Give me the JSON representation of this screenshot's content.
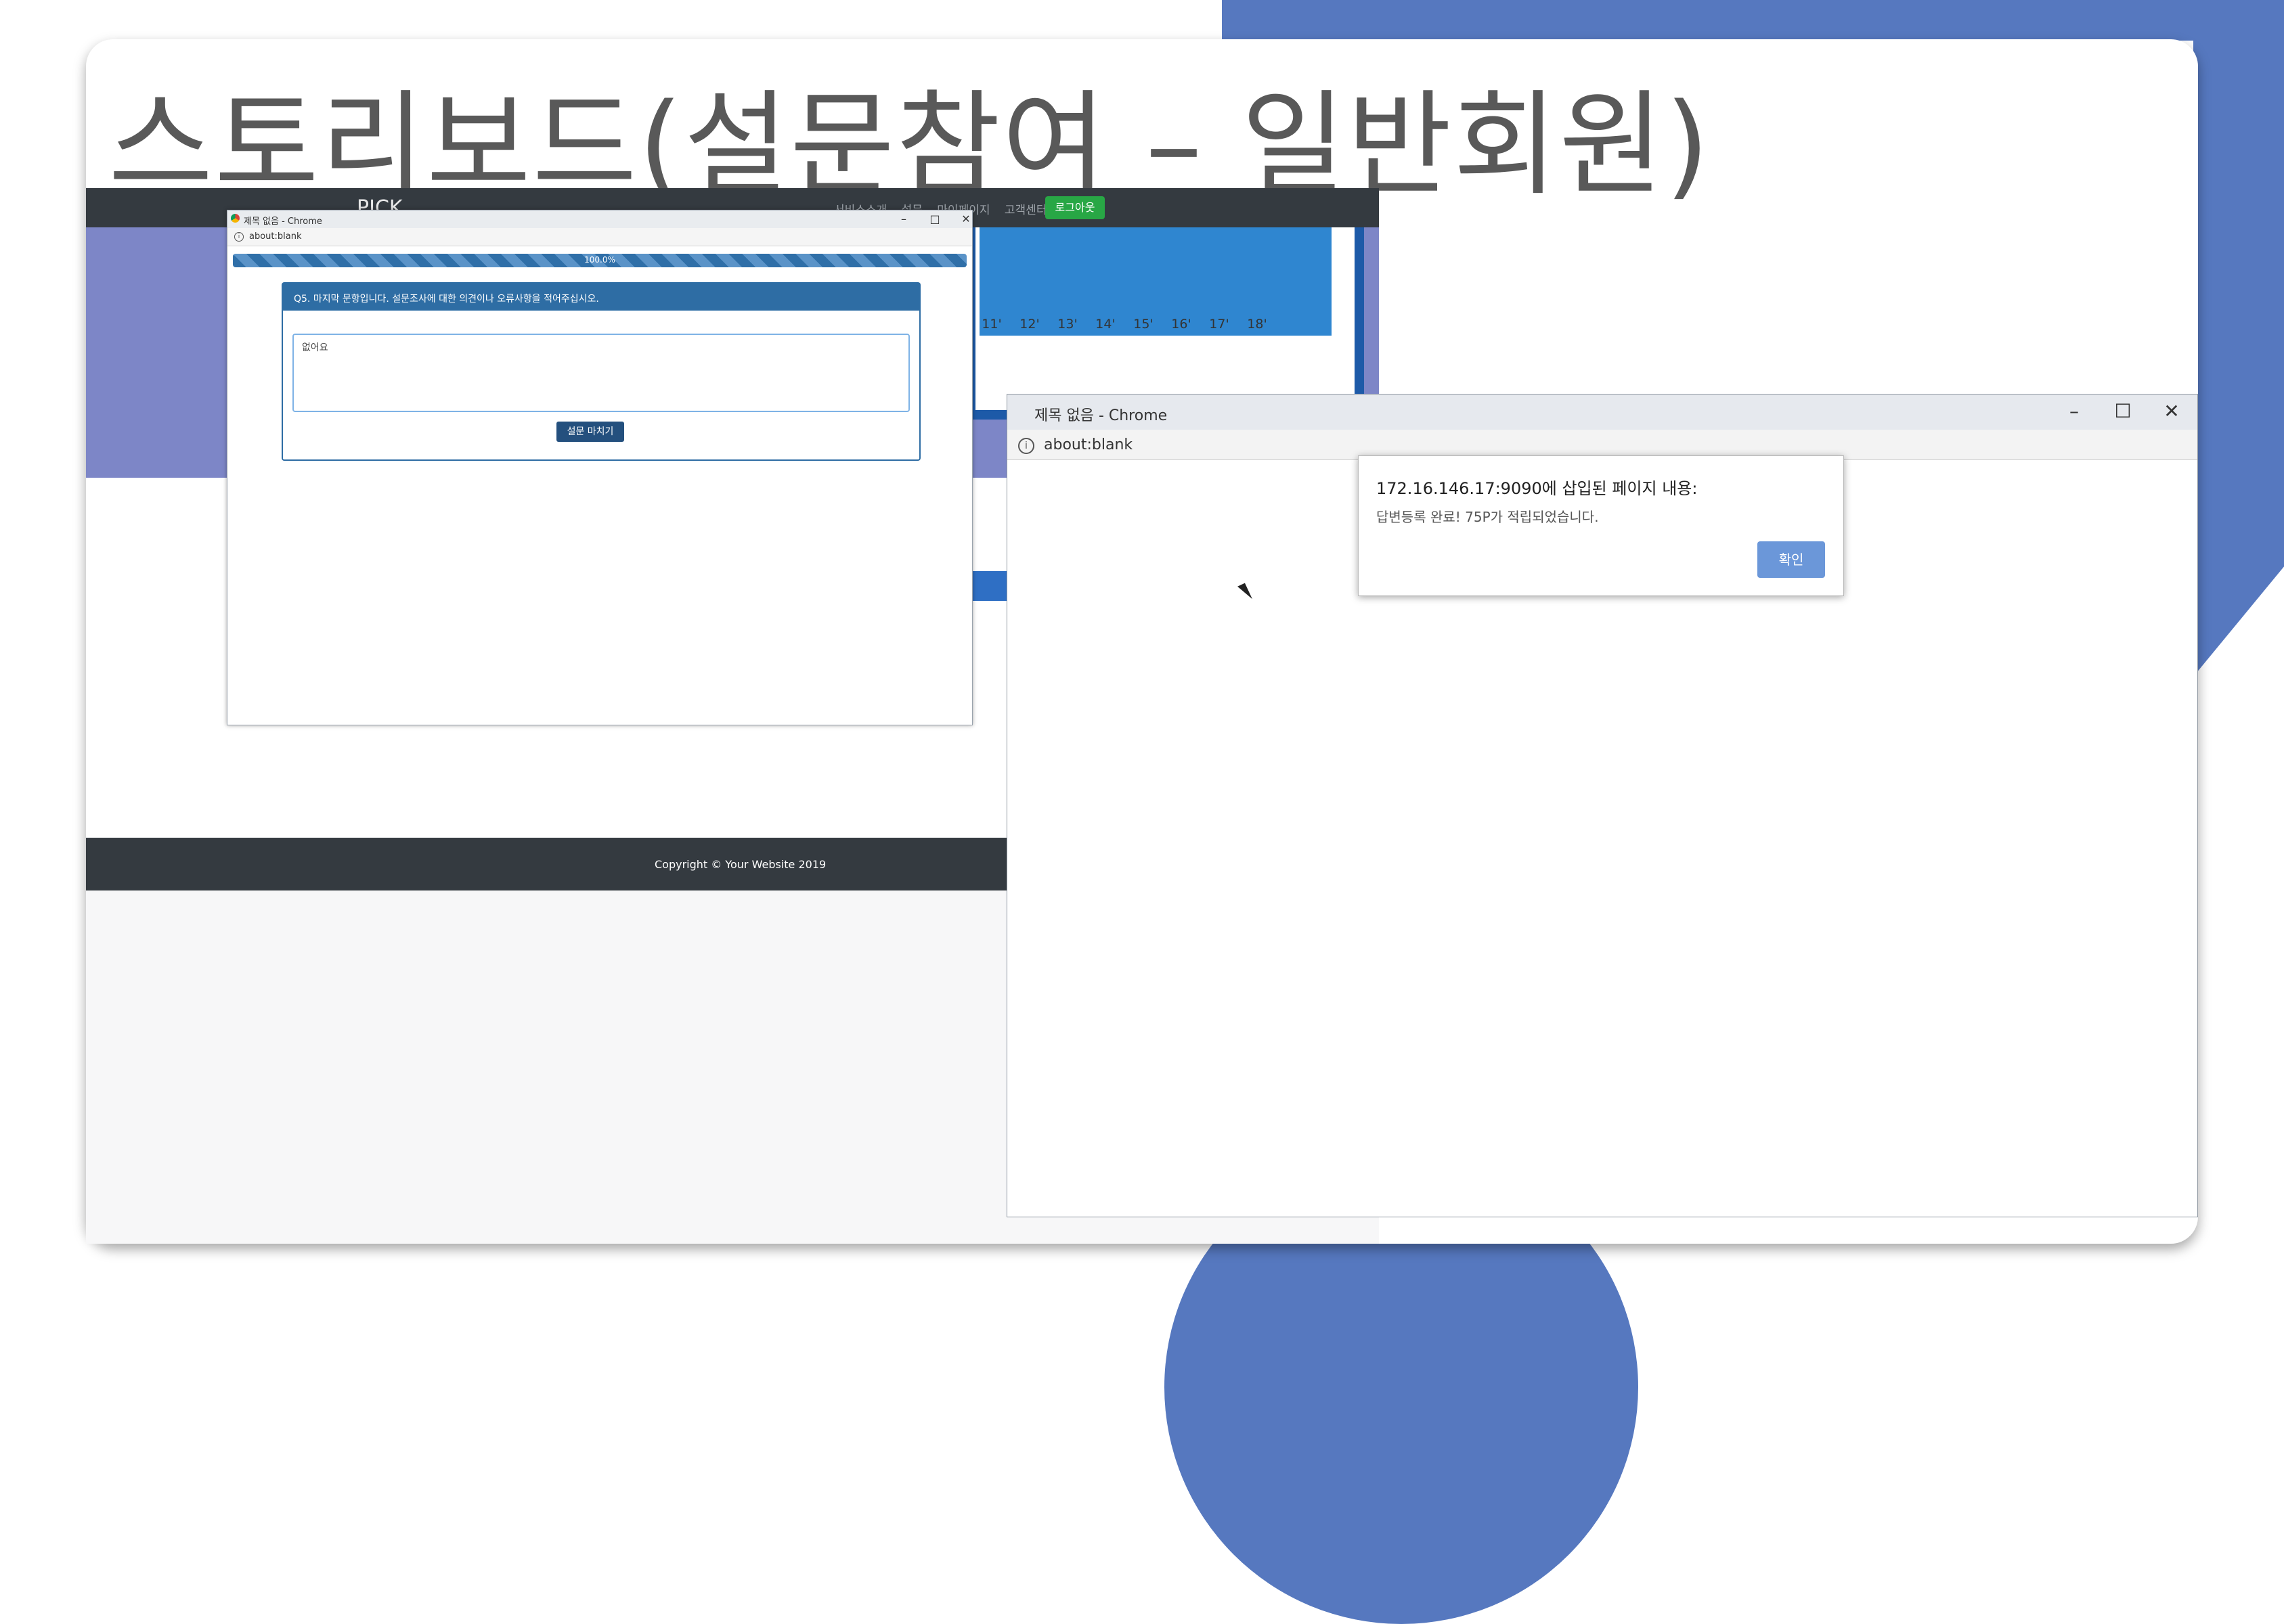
{
  "slide": {
    "title": "스토리보드(설문참여 – 일반회원)"
  },
  "website": {
    "logo": "PICK",
    "nav_links": [
      "서비스소개",
      "설문",
      "마이페이지",
      "고객센터"
    ],
    "logout_label": "로그아웃",
    "chart_labels": [
      "11'",
      "12'",
      "13'",
      "14'",
      "15'",
      "16'",
      "17'",
      "18'"
    ],
    "copyright": "Copyright © Your Website 2019"
  },
  "survey_popup": {
    "window_title": "제목 없음 - Chrome",
    "url": "about:blank",
    "window_controls": [
      "–",
      "□",
      "✕"
    ],
    "progress_label": "100.0%",
    "progress": 1.0,
    "question": "Q5. 마지막 문항입니다. 설문조사에 대한 의견이나 오류사항을 적어주십시오.",
    "answer_value": "없어요",
    "submit_label": "설문 마치기"
  },
  "alert_window": {
    "window_title": "제목 없음 - Chrome",
    "url": "about:blank",
    "window_controls": [
      "–",
      "☐",
      "✕"
    ]
  },
  "alert_dialog": {
    "heading": "172.16.146.17:9090에 삽입된 페이지 내용:",
    "message": "답변등록 완료! 75P가 적립되었습니다.",
    "ok_label": "확인"
  },
  "colors": {
    "accent": "#5678bf",
    "nav": "#343a40",
    "primary": "#2e6da4",
    "success": "#28a745",
    "dialog_button": "#6b97d9"
  }
}
